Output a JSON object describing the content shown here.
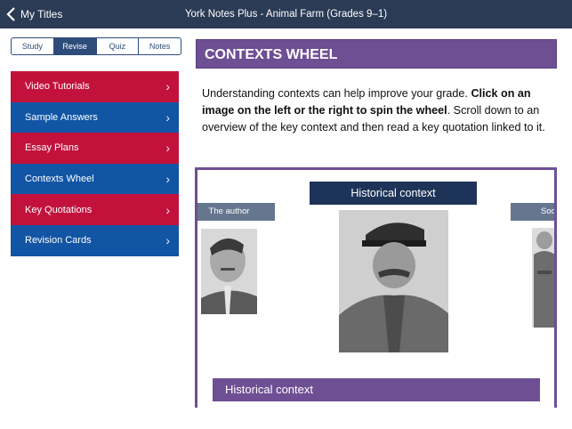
{
  "topbar": {
    "back_label": "My Titles",
    "title": "York Notes Plus - Animal Farm (Grades 9–1)"
  },
  "segments": [
    {
      "label": "Study",
      "active": false
    },
    {
      "label": "Revise",
      "active": true
    },
    {
      "label": "Quiz",
      "active": false
    },
    {
      "label": "Notes",
      "active": false
    }
  ],
  "menu": [
    {
      "label": "Video Tutorials",
      "color": "red"
    },
    {
      "label": "Sample Answers",
      "color": "blue"
    },
    {
      "label": "Essay Plans",
      "color": "red"
    },
    {
      "label": "Contexts Wheel",
      "color": "blue"
    },
    {
      "label": "Key Quotations",
      "color": "red"
    },
    {
      "label": "Revision Cards",
      "color": "blue"
    }
  ],
  "main": {
    "heading": "CONTEXTS WHEEL",
    "intro_part1": "Understanding contexts can help improve your grade. ",
    "intro_bold": "Click on an image on the left or the right to spin the wheel",
    "intro_part2": ". Scroll down to an overview of the key context and then read a key quotation linked to it."
  },
  "wheel": {
    "center_label": "Historical context",
    "left_label": "The author",
    "right_label": "Soc",
    "bottom_label": "Historical context"
  },
  "colors": {
    "topbar": "#2b3a55",
    "red_item": "#c2123c",
    "blue_item": "#1155a4",
    "purple": "#6e4f93",
    "navy_label": "#1e3358",
    "grey_label": "#66768f"
  }
}
